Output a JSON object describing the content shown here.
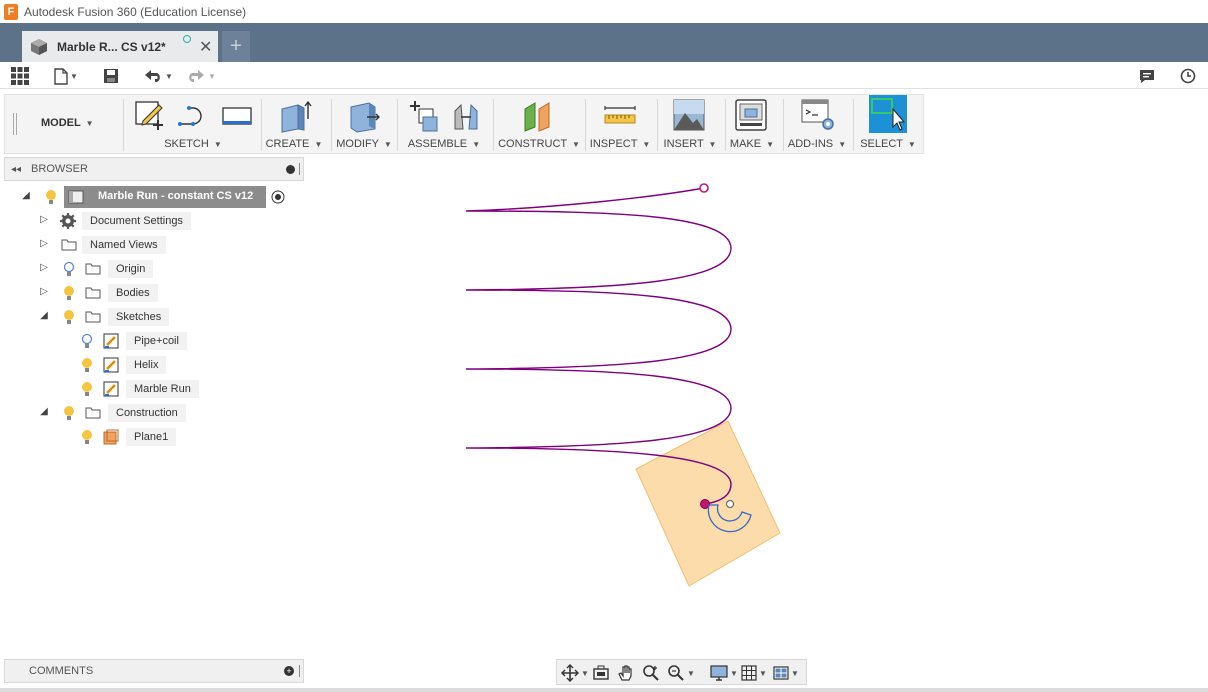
{
  "window": {
    "title": "Autodesk Fusion 360 (Education License)",
    "logo_letter": "F"
  },
  "tabs": [
    {
      "label": "Marble R... CS v12*",
      "close": "✕"
    }
  ],
  "new_tab_label": "+",
  "ribbon": {
    "workspace": "MODEL",
    "groups": [
      {
        "label": "SKETCH"
      },
      {
        "label": "CREATE"
      },
      {
        "label": "MODIFY"
      },
      {
        "label": "ASSEMBLE"
      },
      {
        "label": "CONSTRUCT"
      },
      {
        "label": "INSPECT"
      },
      {
        "label": "INSERT"
      },
      {
        "label": "MAKE"
      },
      {
        "label": "ADD-INS"
      },
      {
        "label": "SELECT"
      }
    ]
  },
  "browser": {
    "title": "BROWSER",
    "root": "Marble Run - constant CS v12",
    "items": [
      {
        "label": "Document Settings"
      },
      {
        "label": "Named Views"
      },
      {
        "label": "Origin"
      },
      {
        "label": "Bodies"
      },
      {
        "label": "Sketches"
      },
      {
        "label": "Pipe+coil"
      },
      {
        "label": "Helix"
      },
      {
        "label": "Marble Run"
      },
      {
        "label": "Construction"
      },
      {
        "label": "Plane1"
      }
    ]
  },
  "comments": {
    "title": "COMMENTS"
  },
  "colors": {
    "tab_bar": "#5c7289",
    "helix_curve": "#800080",
    "plane_fill": "#fcd9a1",
    "profile_curve": "#3366cc",
    "select_active": "#1e90d6"
  }
}
